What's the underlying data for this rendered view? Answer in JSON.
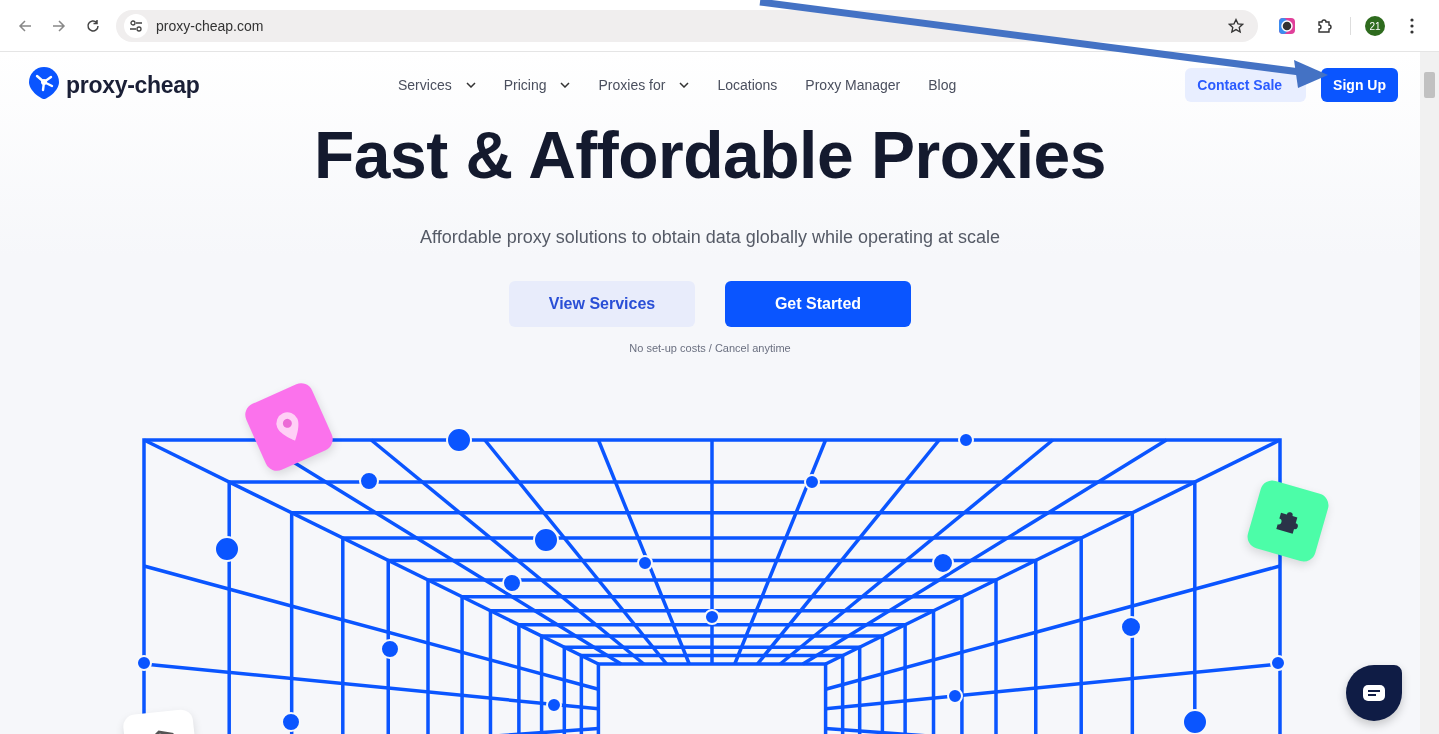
{
  "browser": {
    "url": "proxy-cheap.com",
    "profile_badge": "21"
  },
  "header": {
    "logo": "proxy-cheap",
    "nav": [
      {
        "label": "Services",
        "kind": "dropdown"
      },
      {
        "label": "Pricing",
        "kind": "dropdown"
      },
      {
        "label": "Proxies for",
        "kind": "dropdown"
      },
      {
        "label": "Locations",
        "kind": "link"
      },
      {
        "label": "Proxy Manager",
        "kind": "link"
      },
      {
        "label": "Blog",
        "kind": "link"
      }
    ],
    "contact_button": "Contact Sale",
    "signup_button": "Sign Up"
  },
  "hero": {
    "title": "Fast & Affordable Proxies",
    "subtitle": "Affordable proxy solutions to obtain data globally while operating at scale",
    "secondary_button": "View Services",
    "primary_button": "Get Started",
    "note": "No set-up costs / Cancel anytime"
  }
}
